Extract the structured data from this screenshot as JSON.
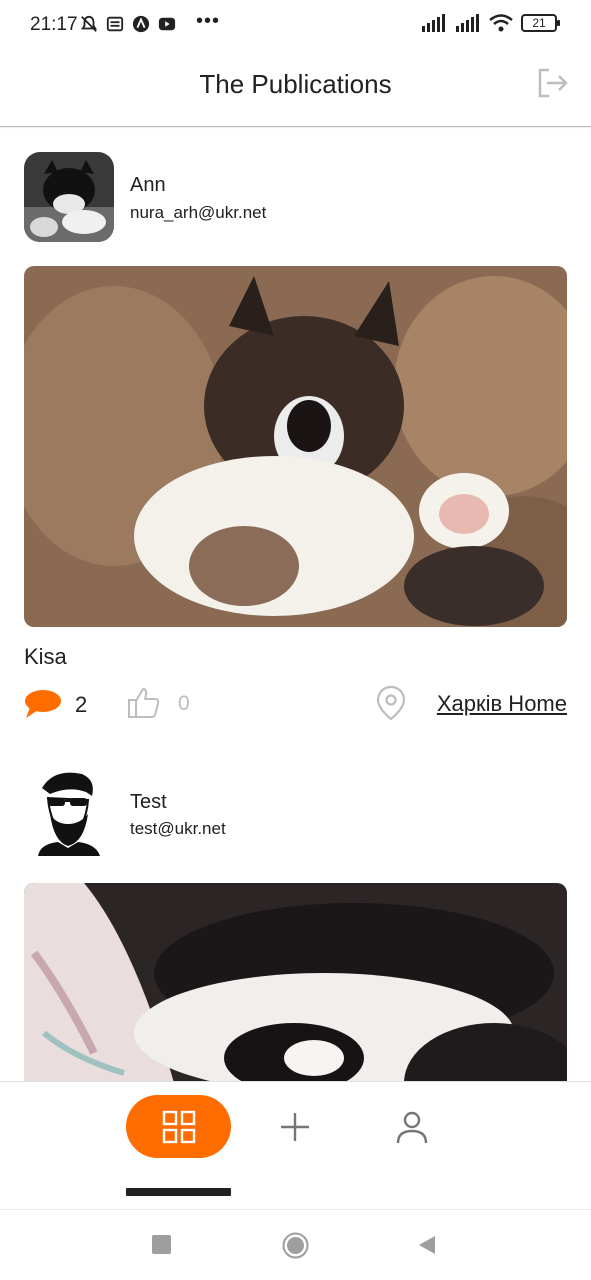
{
  "status_bar": {
    "time": "21:17",
    "dots": "•••",
    "battery": "21",
    "icons": [
      "bell-muted-icon",
      "news-icon",
      "app-icon",
      "youtube-icon",
      "signal-icon",
      "signal-icon",
      "wifi-icon",
      "battery-icon"
    ]
  },
  "header": {
    "title": "The Publications",
    "logout_icon": "logout-icon"
  },
  "posts": [
    {
      "author": {
        "name": "Ann",
        "email": "nura_arh@ukr.net"
      },
      "title": "Kisa",
      "comments": "2",
      "likes": "0",
      "location": "Харків Home"
    },
    {
      "author": {
        "name": "Test",
        "email": "test@ukr.net"
      }
    }
  ],
  "tabbar": {
    "tabs": [
      "grid-icon",
      "plus-icon",
      "user-icon"
    ],
    "active": "grid-icon"
  },
  "colors": {
    "accent": "#FF6C00",
    "text": "#212121",
    "muted": "#BDBDBD"
  }
}
